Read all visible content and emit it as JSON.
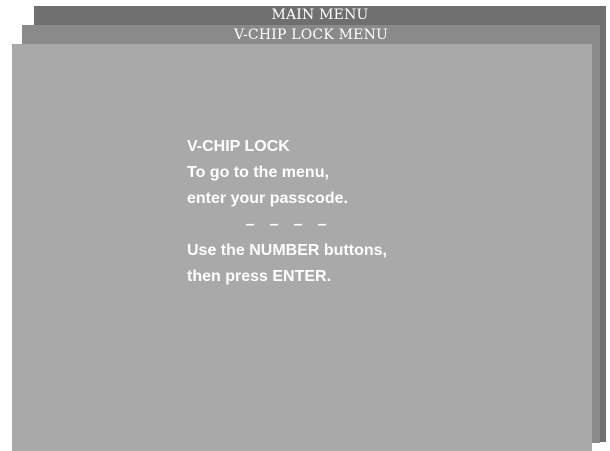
{
  "main_menu": {
    "title": "MAIN MENU"
  },
  "vchip_menu": {
    "title": "V-CHIP LOCK MENU"
  },
  "lock_panel": {
    "heading": "V-CHIP LOCK",
    "line1": "To go to the menu,",
    "line2": "enter your passcode.",
    "passcode_slots": [
      "–",
      "–",
      "–",
      "–"
    ],
    "line3": "Use the NUMBER buttons,",
    "line4": "then press ENTER."
  },
  "colors": {
    "main_menu_bg": "#6f6f6f",
    "vchip_menu_bg": "#8a8a8a",
    "panel_bg": "#a9a9a9",
    "text": "#ffffff"
  }
}
